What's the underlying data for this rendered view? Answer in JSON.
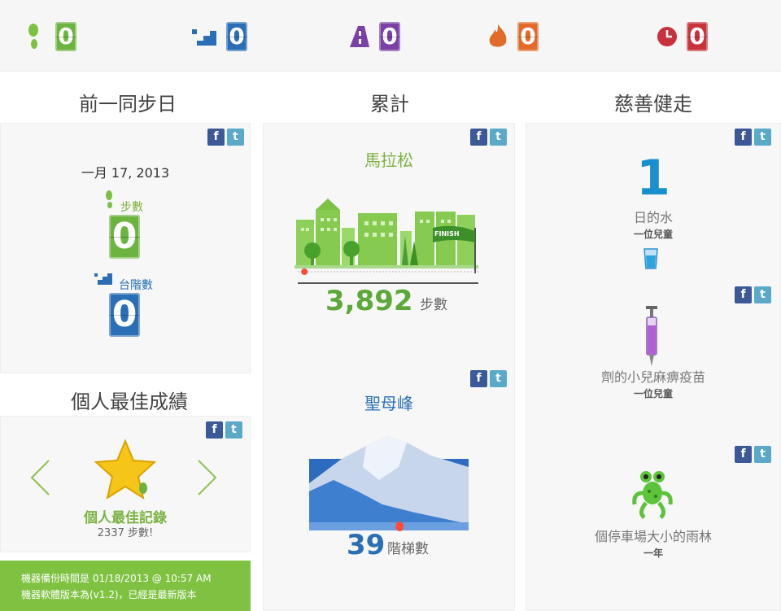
{
  "stats": [
    {
      "icon": "footprint-icon",
      "value": "0",
      "color": "#6cb33f"
    },
    {
      "icon": "stairs-icon",
      "value": "0",
      "color": "#2a6fb5"
    },
    {
      "icon": "road-icon",
      "value": "0",
      "color": "#7b3fa8"
    },
    {
      "icon": "flame-icon",
      "value": "0",
      "color": "#e06b2a"
    },
    {
      "icon": "clock-icon",
      "value": "0",
      "color": "#c8323c"
    }
  ],
  "columns": {
    "previous_sync": "前一同步日",
    "cumulative": "累計",
    "charity_walk": "慈善健走",
    "personal_best": "個人最佳成績"
  },
  "previous_sync": {
    "date": "一月 17, 2013",
    "steps_label": "步數",
    "steps_value": "0",
    "floors_label": "台階數",
    "floors_value": "0"
  },
  "cumulative": {
    "marathon_title": "馬拉松",
    "finish_label": "FINISH",
    "steps_number": "3,892",
    "steps_unit": "步數",
    "marathon_progress": 0.02,
    "mountain_title": "聖母峰",
    "floors_number": "39",
    "floors_unit": "階梯數",
    "mountain_progress": 0.02
  },
  "charity": [
    {
      "number": "1",
      "title": "日的水",
      "sub": "一位兒童",
      "icon": "water-glass-icon"
    },
    {
      "title": "劑的小兒麻痹疫苗",
      "sub": "一位兒童",
      "icon": "syringe-icon"
    },
    {
      "title": "個停車場大小的雨林",
      "sub": "一年",
      "icon": "frog-icon"
    }
  ],
  "personal_best": {
    "title": "個人最佳記錄",
    "value": "2337 步數!"
  },
  "status": {
    "backup_line": "機器備份時間是 01/18/2013 @ 10:57 AM",
    "version_line": "機器軟體版本為(v1.2)，已經是最新版本"
  },
  "share": {
    "facebook": "f",
    "twitter": "t"
  }
}
